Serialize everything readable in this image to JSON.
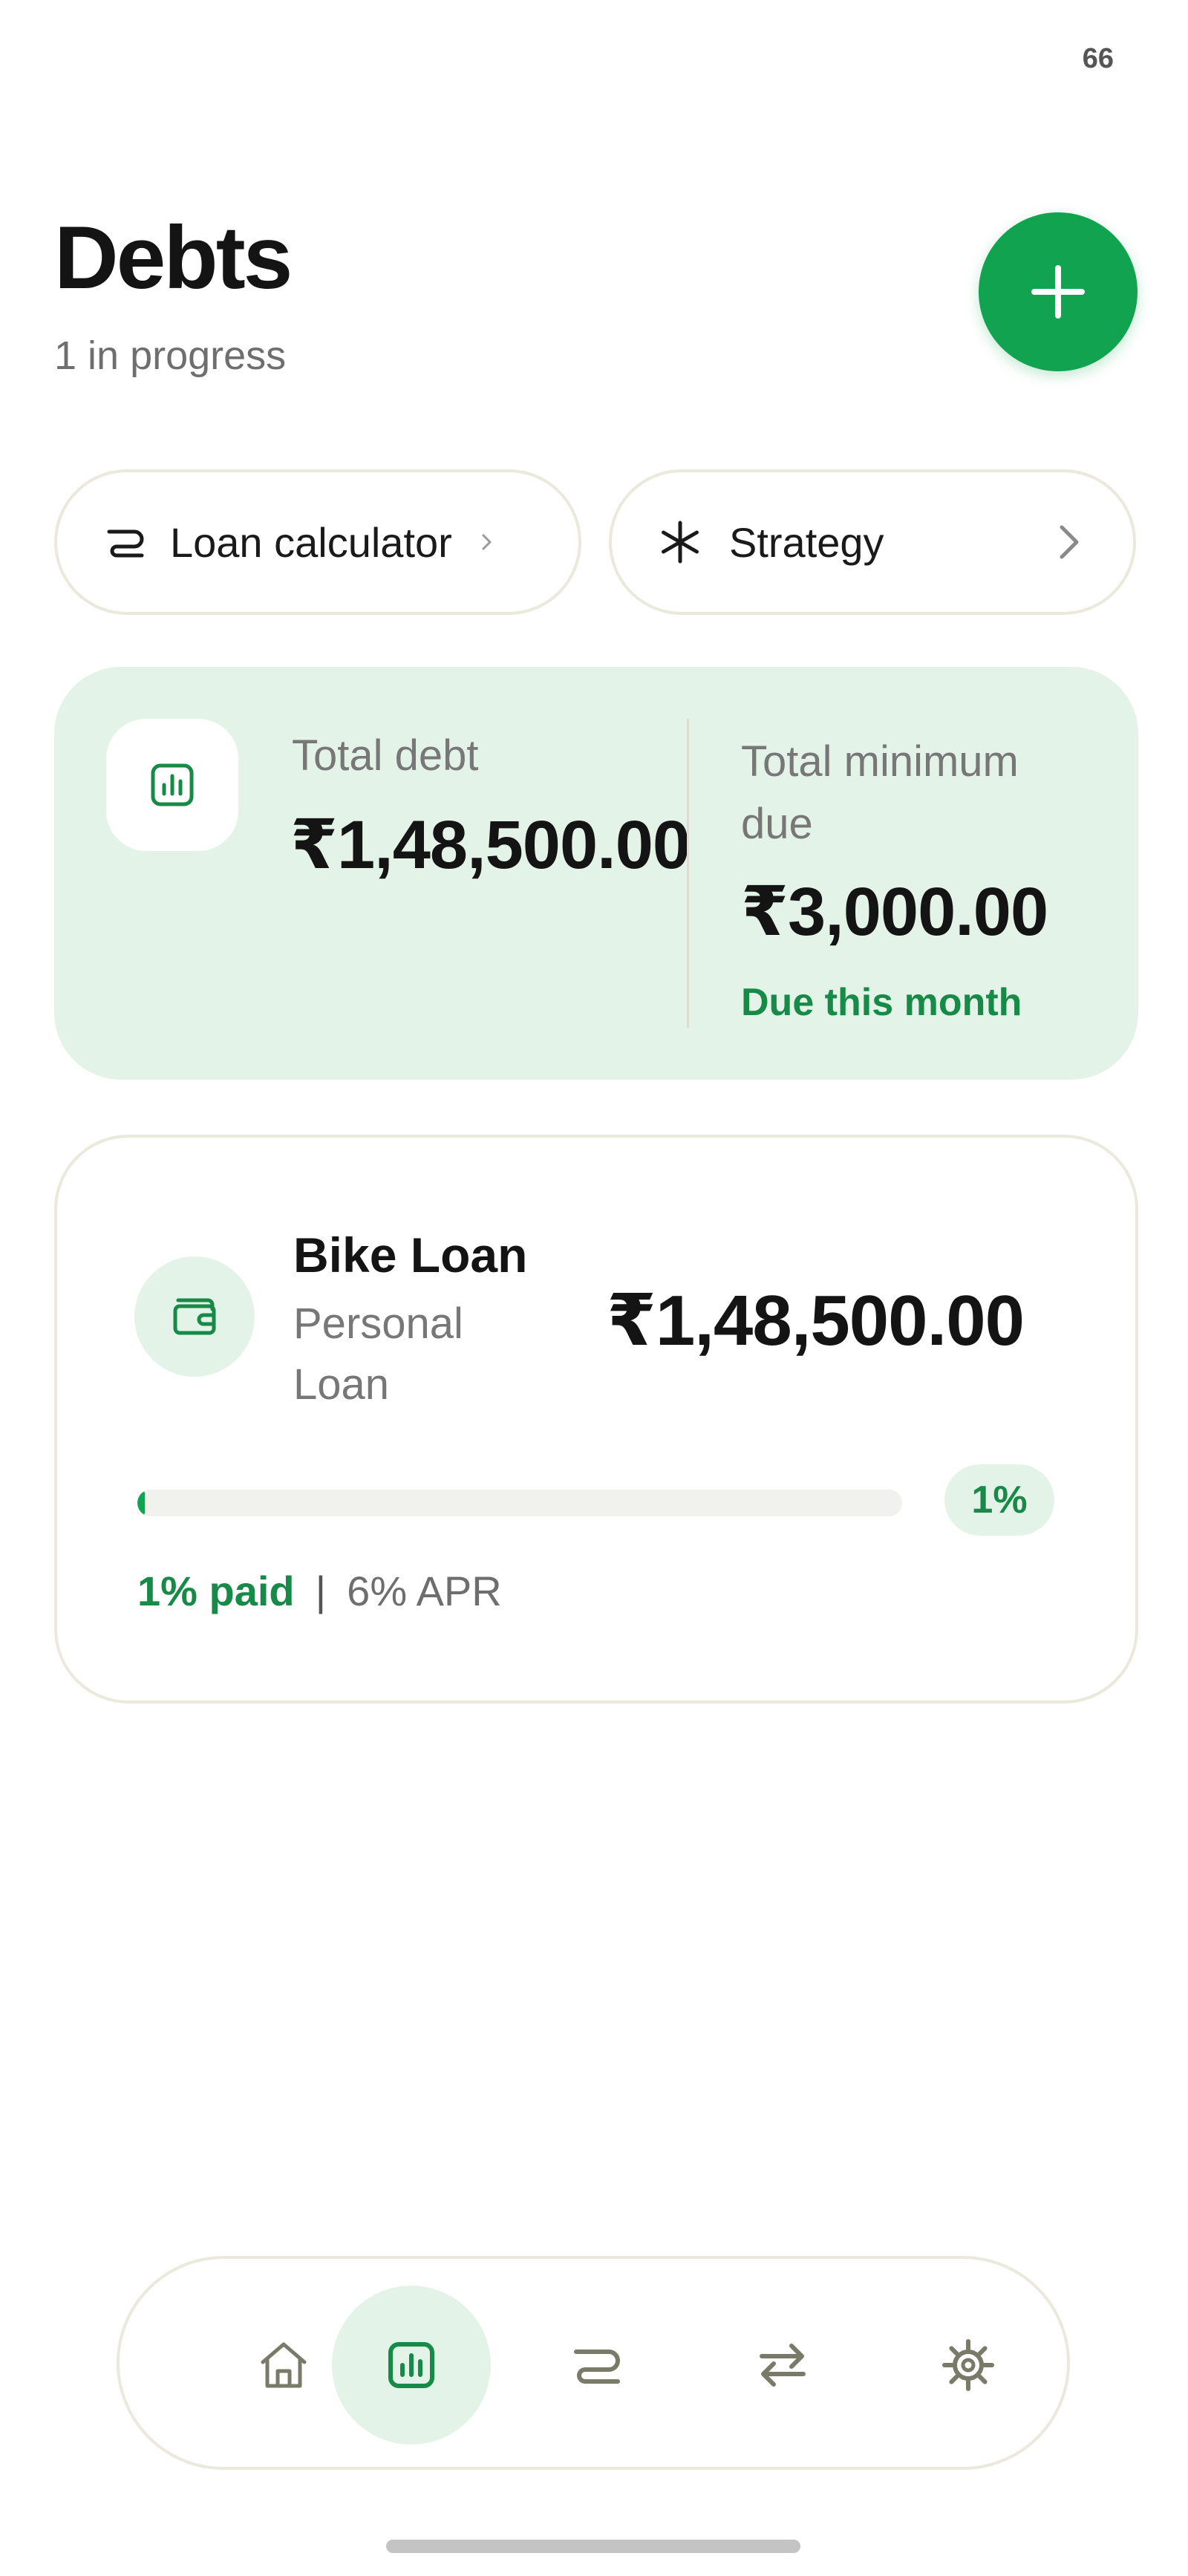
{
  "status_bar": {
    "number": "66"
  },
  "header": {
    "title": "Debts",
    "subtitle": "1 in progress"
  },
  "actions": {
    "loan_calculator": {
      "label": "Loan calculator",
      "icon": "loan-calculator-icon"
    },
    "strategy": {
      "label": "Strategy",
      "icon": "asterisk-icon"
    }
  },
  "summary": {
    "total_debt_label": "Total debt",
    "total_debt_value": "₹1,48,500.00",
    "min_due_label": "Total minimum due",
    "min_due_value": "₹3,000.00",
    "due_note": "Due this month",
    "icon": "chart-icon"
  },
  "loans": [
    {
      "name": "Bike Loan",
      "type": "Personal Loan",
      "amount": "₹1,48,500.00",
      "progress_pct": 1,
      "progress_label": "1%",
      "paid_label": "1% paid",
      "separator": "|",
      "apr_label": "6% APR",
      "icon": "wallet-icon"
    }
  ],
  "bottom_nav": [
    {
      "name": "home",
      "icon": "home-icon",
      "active": false
    },
    {
      "name": "debts",
      "icon": "chart-icon",
      "active": true
    },
    {
      "name": "loans",
      "icon": "loan-calculator-icon",
      "active": false
    },
    {
      "name": "transfers",
      "icon": "transfer-icon",
      "active": false
    },
    {
      "name": "settings",
      "icon": "gear-icon",
      "active": false
    }
  ],
  "colors": {
    "accent": "#12a350",
    "accent_text": "#168a46",
    "card_bg": "#e4f3e8",
    "border": "#ebe8dc"
  }
}
